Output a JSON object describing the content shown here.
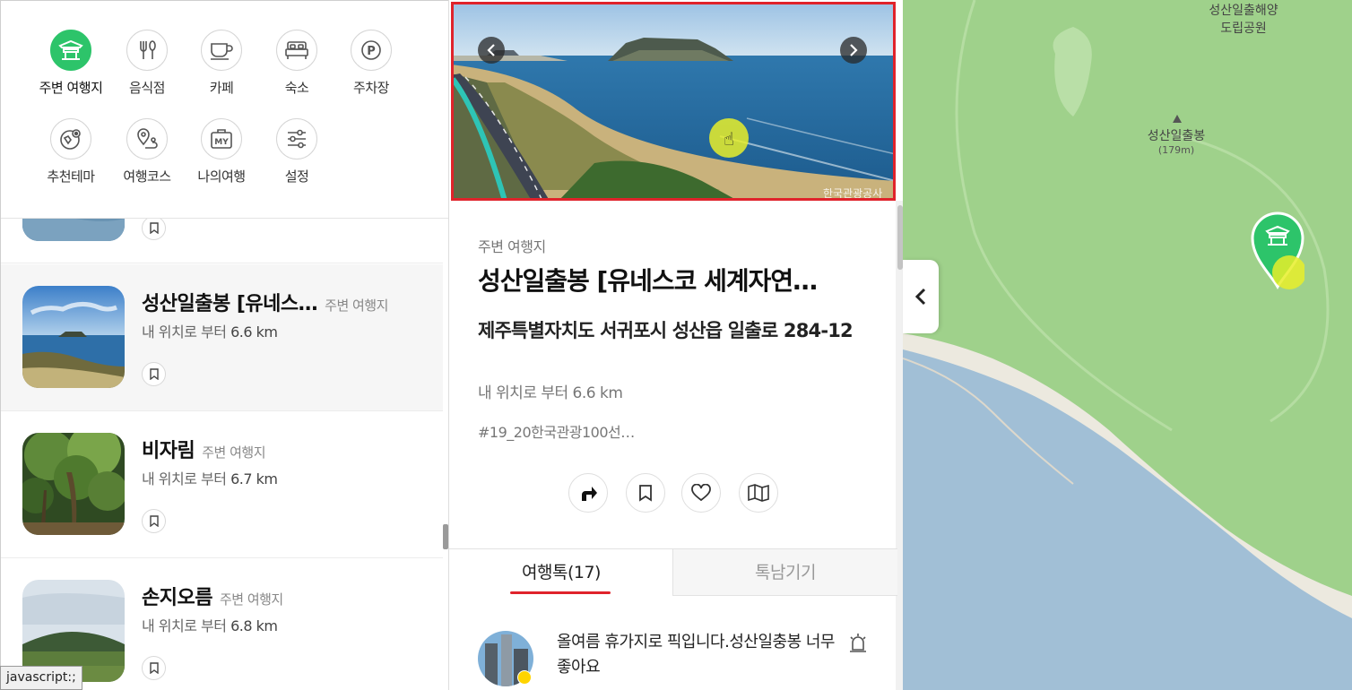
{
  "categories": [
    {
      "label": "주변 여행지",
      "icon": "pavilion-icon",
      "active": true
    },
    {
      "label": "음식점",
      "icon": "fork-knife-icon"
    },
    {
      "label": "카페",
      "icon": "coffee-cup-icon"
    },
    {
      "label": "숙소",
      "icon": "bed-icon"
    },
    {
      "label": "주차장",
      "icon": "parking-icon"
    },
    {
      "label": "추천테마",
      "icon": "theme-map-icon"
    },
    {
      "label": "여행코스",
      "icon": "route-pin-icon"
    },
    {
      "label": "나의여행",
      "icon": "my-bag-icon"
    },
    {
      "label": "설정",
      "icon": "sliders-icon"
    }
  ],
  "list": [
    {
      "name": "성산일출봉 [유네스…",
      "type": "주변 여행지",
      "dist_prefix": "내 위치로 부터",
      "dist": "6.6 km",
      "selected": true
    },
    {
      "name": "비자림",
      "type": "주변 여행지",
      "dist_prefix": "내 위치로 부터",
      "dist": "6.7 km"
    },
    {
      "name": "손지오름",
      "type": "주변 여행지",
      "dist_prefix": "내 위치로 부터",
      "dist": "6.8 km"
    }
  ],
  "status_bar": "javascript:;",
  "detail": {
    "photo_watermark": "한국관광공사",
    "category": "주변 여행지",
    "title": "성산일출봉 [유네스코 세계자연…",
    "address": "제주특별자치도 서귀포시 성산읍 일출로 284-12",
    "distance": "내 위치로 부터 6.6 km",
    "tags": "#19_20한국관광100선…",
    "actions": [
      "directions-icon",
      "bookmark-icon",
      "heart-icon",
      "map-fold-icon"
    ],
    "tabs": {
      "talk": "여행톡(17)",
      "leave": "톡남기기"
    },
    "comment": {
      "text": "올여름 휴가지로 픽입니다.성산일충봉 너무 좋아요"
    }
  },
  "map": {
    "park_label_1": "성산일출해양",
    "park_label_2": "도립공원",
    "peak_name": "성산일출봉",
    "peak_elev": "(179m)",
    "colors": {
      "land": "#9fd18b",
      "sea": "#a1bfd6",
      "beach": "#ece9df",
      "marker": "#2dc46a",
      "accent": "#e0232b"
    }
  }
}
